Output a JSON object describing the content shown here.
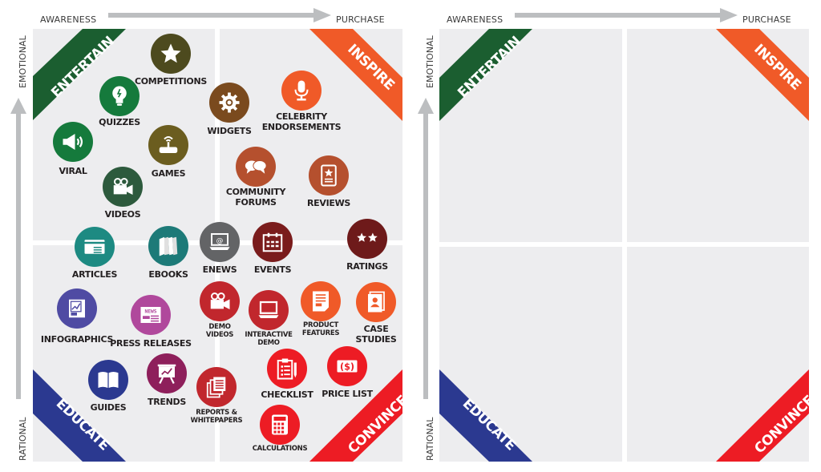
{
  "axes": {
    "x_start": "AWARENESS",
    "x_end": "PURCHASE",
    "y_top": "EMOTIONAL",
    "y_bottom": "RATIONAL"
  },
  "quadrants": {
    "entertain": {
      "label": "ENTERTAIN",
      "color": "#1b5e30"
    },
    "inspire": {
      "label": "INSPIRE",
      "color": "#f05a28"
    },
    "educate": {
      "label": "EDUCATE",
      "color": "#2b3990"
    },
    "convince": {
      "label": "CONVINCE",
      "color": "#ed1c24"
    }
  },
  "colors": {
    "panel": "#ededef",
    "arrow": "#bcbec0",
    "text": "#231f20"
  },
  "content_items": [
    {
      "label": "COMPETITIONS",
      "icon": "star-icon",
      "color": "#4d4a1e"
    },
    {
      "label": "QUIZZES",
      "icon": "lightbulb-icon",
      "color": "#157a3c"
    },
    {
      "label": "VIRAL",
      "icon": "megaphone-icon",
      "color": "#157a3c"
    },
    {
      "label": "GAMES",
      "icon": "joystick-icon",
      "color": "#6b5d1f"
    },
    {
      "label": "VIDEOS",
      "icon": "video-camera-icon",
      "color": "#2d5a3d"
    },
    {
      "label": "WIDGETS",
      "icon": "gear-icon",
      "color": "#7a4a1e"
    },
    {
      "label": "CELEBRITY ENDORSEMENTS",
      "icon": "microphone-icon",
      "color": "#f05a28"
    },
    {
      "label": "COMMUNITY FORUMS",
      "icon": "speech-bubbles-icon",
      "color": "#b5502e"
    },
    {
      "label": "REVIEWS",
      "icon": "review-tablet-icon",
      "color": "#b5502e"
    },
    {
      "label": "ARTICLES",
      "icon": "article-icon",
      "color": "#1d8a82"
    },
    {
      "label": "EBOOKS",
      "icon": "books-icon",
      "color": "#1d7a78"
    },
    {
      "label": "ENEWS",
      "icon": "laptop-email-icon",
      "color": "#636466"
    },
    {
      "label": "EVENTS",
      "icon": "calendar-icon",
      "color": "#7a1c1c"
    },
    {
      "label": "RATINGS",
      "icon": "two-stars-icon",
      "color": "#6e1a1a"
    },
    {
      "label": "INFOGRAPHICS",
      "icon": "infographic-icon",
      "color": "#4f4ba3"
    },
    {
      "label": "PRESS RELEASES",
      "icon": "newspaper-icon",
      "color": "#b0489c"
    },
    {
      "label": "DEMO VIDEOS",
      "icon": "video-camera-icon",
      "color": "#c1272d"
    },
    {
      "label": "INTERACTIVE DEMO",
      "icon": "laptop-icon",
      "color": "#c1272d"
    },
    {
      "label": "PRODUCT FEATURES",
      "icon": "document-icon",
      "color": "#f05a28"
    },
    {
      "label": "CASE STUDIES",
      "icon": "profile-document-icon",
      "color": "#f05a28"
    },
    {
      "label": "GUIDES",
      "icon": "open-book-icon",
      "color": "#2b3990"
    },
    {
      "label": "TRENDS",
      "icon": "presentation-chart-icon",
      "color": "#8e1f5b"
    },
    {
      "label": "REPORTS & WHITEPAPERS",
      "icon": "stacked-documents-icon",
      "color": "#c1272d"
    },
    {
      "label": "CHECKLIST",
      "icon": "clipboard-checklist-icon",
      "color": "#ed1c24"
    },
    {
      "label": "PRICE LIST",
      "icon": "dollar-bill-icon",
      "color": "#ed1c24"
    },
    {
      "label": "CALCULATIONS",
      "icon": "calculator-icon",
      "color": "#ed1c24"
    }
  ]
}
